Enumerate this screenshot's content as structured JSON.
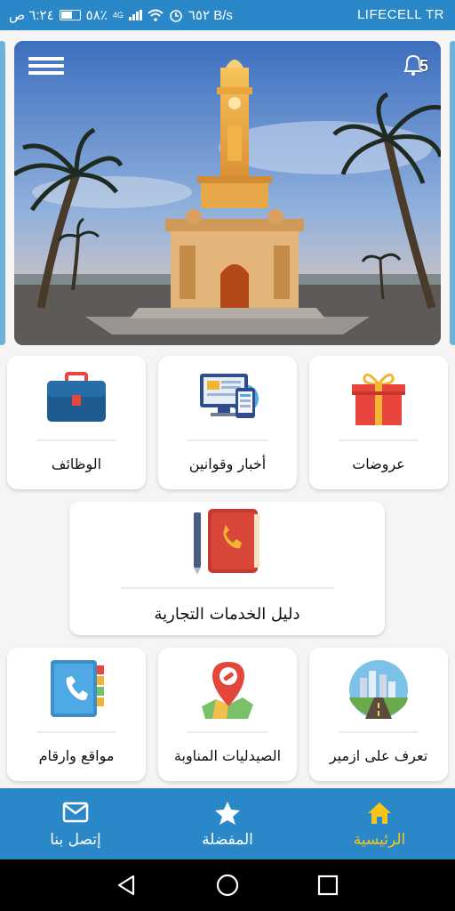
{
  "status_bar": {
    "time": "٦:٢٤ ص",
    "battery": "٥٨٪",
    "network": "4G",
    "speed": "٦٥٢ B/s",
    "carrier": "LIFECELL TR"
  },
  "hero": {
    "notification_count": "5"
  },
  "tiles": {
    "offers": "عروضات",
    "news": "أخبار وقوانين",
    "jobs": "الوظائف",
    "directory": "دليل الخدمات التجارية",
    "izmir": "تعرف على ازمير",
    "pharmacies": "الصيدليات المناوبة",
    "places": "مواقع وارقام"
  },
  "bottom_nav": {
    "home": "الرئيسية",
    "favorites": "المفضلة",
    "contact": "إتصل بنا"
  },
  "colors": {
    "primary": "#2a88c9",
    "active_nav": "#f5c518"
  }
}
